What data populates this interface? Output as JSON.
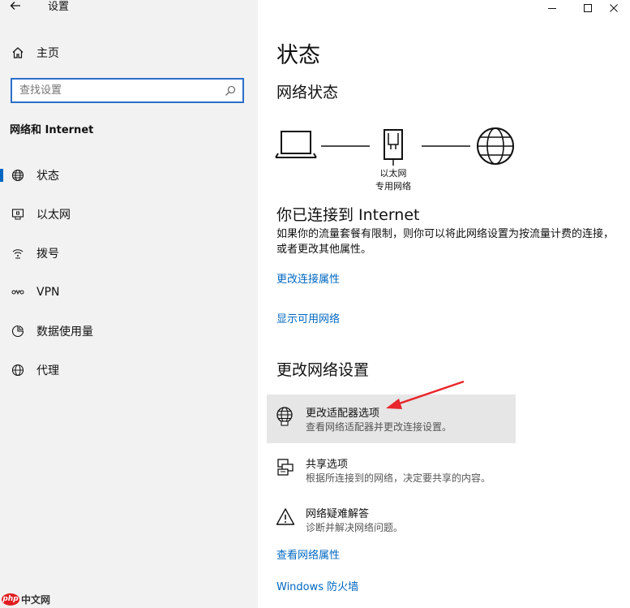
{
  "window": {
    "title": "设置",
    "controls": [
      "minimize",
      "maximize",
      "close"
    ]
  },
  "sidebar": {
    "home_label": "主页",
    "search_placeholder": "查找设置",
    "section_title": "网络和 Internet",
    "items": [
      {
        "label": "状态",
        "icon": "globe-icon",
        "active": true
      },
      {
        "label": "以太网",
        "icon": "ethernet-icon",
        "active": false
      },
      {
        "label": "拨号",
        "icon": "dialup-icon",
        "active": false
      },
      {
        "label": "VPN",
        "icon": "vpn-icon",
        "active": false
      },
      {
        "label": "数据使用量",
        "icon": "data-usage-icon",
        "active": false
      },
      {
        "label": "代理",
        "icon": "proxy-globe-icon",
        "active": false
      }
    ]
  },
  "main": {
    "page_title": "状态",
    "network_status_heading": "网络状态",
    "diagram": {
      "adapter_caption_line1": "以太网",
      "adapter_caption_line2": "专用网络"
    },
    "connected_heading": "你已连接到 Internet",
    "connected_desc": "如果你的流量套餐有限制，则你可以将此网络设置为按流量计费的连接，或者更改其他属性。",
    "links": {
      "change_connection_properties": "更改连接属性",
      "show_available_networks": "显示可用网络",
      "view_network_properties": "查看网络属性",
      "windows_firewall": "Windows 防火墙"
    },
    "change_settings_heading": "更改网络设置",
    "options": [
      {
        "title": "更改适配器选项",
        "desc": "查看网络适配器并更改连接设置。",
        "icon": "adapter-globe-icon",
        "highlighted": true
      },
      {
        "title": "共享选项",
        "desc": "根据所连接到的网络，决定要共享的内容。",
        "icon": "sharing-icon",
        "highlighted": false
      },
      {
        "title": "网络疑难解答",
        "desc": "诊断并解决网络问题。",
        "icon": "warning-icon",
        "highlighted": false
      }
    ]
  },
  "watermark": {
    "badge": "php",
    "text": "中文网"
  },
  "colors": {
    "accent": "#0067c0",
    "sidebar_bg": "#f2f2f2",
    "highlight_bg": "#e6e6e6",
    "annotation_arrow": "#e8262b"
  }
}
